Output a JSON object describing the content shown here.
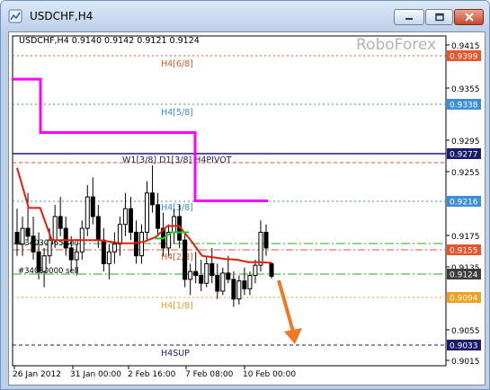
{
  "window": {
    "title": "USDCHF,H4",
    "min_label": "",
    "max_label": "",
    "close_label": ""
  },
  "chart_info": {
    "symbol_line": "USDCHF,H4  0.9140 0.9142 0.9121 0.9124",
    "watermark": "RoboForex"
  },
  "chart_data": {
    "type": "candlestick",
    "symbol": "USDCHF",
    "timeframe": "H4",
    "ohlc_last": {
      "open": 0.914,
      "high": 0.9142,
      "low": 0.9121,
      "close": 0.9124
    },
    "ylim": [
      0.901,
      0.943
    ],
    "y_ticks": [
      "0.9415",
      "0.9355",
      "0.9295",
      "0.9255",
      "0.9175",
      "0.9135",
      "0.9055",
      "0.9015"
    ],
    "x_ticks": [
      "26 Jan 2012",
      "31 Jan 00:00",
      "2 Feb 16:00",
      "7 Feb 08:00",
      "10 Feb 00:00"
    ],
    "levels": [
      {
        "label": "H4[6/8]",
        "value": "0.9399",
        "color": "#e8542c",
        "style": "dotted"
      },
      {
        "label": "H4[5/8]",
        "value": "0.9338",
        "color": "#3a8fd8",
        "style": "dotted"
      },
      {
        "label": "W1[3/8] D1[3/8] H4PIVOT",
        "value": "0.9277",
        "color": "#1b1b6e",
        "style": "solid"
      },
      {
        "label": "",
        "value": "0.9216",
        "color": "#3a8fd8",
        "style": "dotted"
      },
      {
        "label": "H4[3/8]",
        "value": "",
        "color": "#3a8fd8",
        "style": "dotted"
      },
      {
        "label": "",
        "value": "0.9155",
        "color": "#e8542c",
        "style": "dashdot"
      },
      {
        "label": "H4[2/8]",
        "value": "",
        "color": "#e8542c",
        "style": "none"
      },
      {
        "label": "",
        "value": "0.9124",
        "color": "#3c3c3c",
        "style": "none"
      },
      {
        "label": "H4[1/8]",
        "value": "0.9094",
        "color": "#f0a020",
        "style": "dotted"
      },
      {
        "label": "H4SUP",
        "value": "0.9033",
        "color": "#1b1b6e",
        "style": "dashed"
      }
    ],
    "order_labels": [
      "#34030065 sell",
      "#34030000 sell"
    ],
    "magenta_line": [
      0.9375,
      0.9375,
      0.9307,
      0.9307,
      0.922,
      0.922
    ],
    "red_line": [
      0.9262,
      0.9211,
      0.9211,
      0.917,
      0.917,
      0.917,
      0.917,
      0.917,
      0.9168,
      0.9166,
      0.9166,
      0.9168,
      0.9174,
      0.9188,
      0.9188,
      0.917,
      0.915,
      0.9148,
      0.9146,
      0.9145,
      0.9142,
      0.9142,
      0.9141
    ],
    "green_line": [
      0.9172,
      0.9172,
      0.918,
      0.918,
      0.918
    ],
    "candles": [
      {
        "o": 0.918,
        "h": 0.921,
        "l": 0.915,
        "c": 0.9165
      },
      {
        "o": 0.9165,
        "h": 0.92,
        "l": 0.915,
        "c": 0.9185
      },
      {
        "o": 0.9185,
        "h": 0.923,
        "l": 0.917,
        "c": 0.9175
      },
      {
        "o": 0.9175,
        "h": 0.92,
        "l": 0.9145,
        "c": 0.9155
      },
      {
        "o": 0.9155,
        "h": 0.918,
        "l": 0.912,
        "c": 0.913
      },
      {
        "o": 0.913,
        "h": 0.916,
        "l": 0.911,
        "c": 0.915
      },
      {
        "o": 0.915,
        "h": 0.9185,
        "l": 0.914,
        "c": 0.917
      },
      {
        "o": 0.917,
        "h": 0.9215,
        "l": 0.916,
        "c": 0.92
      },
      {
        "o": 0.92,
        "h": 0.9225,
        "l": 0.9175,
        "c": 0.9185
      },
      {
        "o": 0.9185,
        "h": 0.92,
        "l": 0.915,
        "c": 0.916
      },
      {
        "o": 0.916,
        "h": 0.9175,
        "l": 0.913,
        "c": 0.9145
      },
      {
        "o": 0.9145,
        "h": 0.9165,
        "l": 0.9125,
        "c": 0.9155
      },
      {
        "o": 0.9155,
        "h": 0.9195,
        "l": 0.9145,
        "c": 0.9185
      },
      {
        "o": 0.9185,
        "h": 0.924,
        "l": 0.9175,
        "c": 0.9225
      },
      {
        "o": 0.9225,
        "h": 0.925,
        "l": 0.919,
        "c": 0.92
      },
      {
        "o": 0.92,
        "h": 0.9215,
        "l": 0.916,
        "c": 0.917
      },
      {
        "o": 0.917,
        "h": 0.9185,
        "l": 0.913,
        "c": 0.914
      },
      {
        "o": 0.914,
        "h": 0.9165,
        "l": 0.912,
        "c": 0.9155
      },
      {
        "o": 0.9155,
        "h": 0.918,
        "l": 0.914,
        "c": 0.9165
      },
      {
        "o": 0.9165,
        "h": 0.92,
        "l": 0.915,
        "c": 0.919
      },
      {
        "o": 0.919,
        "h": 0.923,
        "l": 0.9175,
        "c": 0.921
      },
      {
        "o": 0.921,
        "h": 0.9225,
        "l": 0.917,
        "c": 0.918
      },
      {
        "o": 0.918,
        "h": 0.9195,
        "l": 0.914,
        "c": 0.915
      },
      {
        "o": 0.915,
        "h": 0.919,
        "l": 0.914,
        "c": 0.918
      },
      {
        "o": 0.918,
        "h": 0.9245,
        "l": 0.917,
        "c": 0.923
      },
      {
        "o": 0.923,
        "h": 0.9265,
        "l": 0.9205,
        "c": 0.9215
      },
      {
        "o": 0.9215,
        "h": 0.923,
        "l": 0.9175,
        "c": 0.9185
      },
      {
        "o": 0.9185,
        "h": 0.9205,
        "l": 0.915,
        "c": 0.916
      },
      {
        "o": 0.916,
        "h": 0.919,
        "l": 0.915,
        "c": 0.918
      },
      {
        "o": 0.918,
        "h": 0.921,
        "l": 0.9165,
        "c": 0.92
      },
      {
        "o": 0.92,
        "h": 0.9215,
        "l": 0.916,
        "c": 0.917
      },
      {
        "o": 0.917,
        "h": 0.918,
        "l": 0.911,
        "c": 0.912
      },
      {
        "o": 0.912,
        "h": 0.914,
        "l": 0.91,
        "c": 0.913
      },
      {
        "o": 0.913,
        "h": 0.9155,
        "l": 0.9115,
        "c": 0.9125
      },
      {
        "o": 0.9125,
        "h": 0.9145,
        "l": 0.9105,
        "c": 0.9115
      },
      {
        "o": 0.9115,
        "h": 0.915,
        "l": 0.911,
        "c": 0.914
      },
      {
        "o": 0.914,
        "h": 0.916,
        "l": 0.9115,
        "c": 0.9125
      },
      {
        "o": 0.9125,
        "h": 0.914,
        "l": 0.9095,
        "c": 0.9105
      },
      {
        "o": 0.9105,
        "h": 0.9135,
        "l": 0.91,
        "c": 0.9128
      },
      {
        "o": 0.9128,
        "h": 0.915,
        "l": 0.9115,
        "c": 0.912
      },
      {
        "o": 0.912,
        "h": 0.913,
        "l": 0.9085,
        "c": 0.9095
      },
      {
        "o": 0.9095,
        "h": 0.9125,
        "l": 0.9088,
        "c": 0.9118
      },
      {
        "o": 0.9118,
        "h": 0.9135,
        "l": 0.91,
        "c": 0.9108
      },
      {
        "o": 0.9108,
        "h": 0.913,
        "l": 0.91,
        "c": 0.9125
      },
      {
        "o": 0.9125,
        "h": 0.9145,
        "l": 0.9115,
        "c": 0.9138
      },
      {
        "o": 0.9138,
        "h": 0.9195,
        "l": 0.913,
        "c": 0.918
      },
      {
        "o": 0.918,
        "h": 0.919,
        "l": 0.915,
        "c": 0.916
      },
      {
        "o": 0.914,
        "h": 0.9142,
        "l": 0.9121,
        "c": 0.9124
      }
    ]
  },
  "colors": {
    "magenta": "#ff00ff",
    "red": "#e81c0c",
    "green": "#22cc22",
    "arrow": "#f07820",
    "candle": "#000000"
  }
}
